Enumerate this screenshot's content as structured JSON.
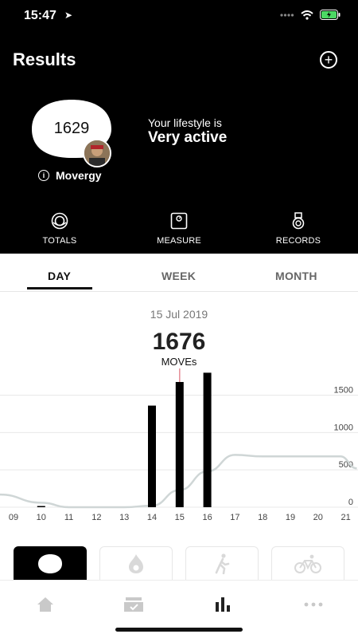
{
  "status_bar": {
    "time": "15:47"
  },
  "header": {
    "title": "Results"
  },
  "score": {
    "value": "1629",
    "name": "Movergy"
  },
  "lifestyle": {
    "label": "Your lifestyle is",
    "value": "Very active"
  },
  "top_nav": [
    {
      "label": "TOTALS",
      "icon": "totals-icon"
    },
    {
      "label": "MEASURE",
      "icon": "scale-icon"
    },
    {
      "label": "RECORDS",
      "icon": "medal-icon"
    }
  ],
  "tabs": [
    {
      "label": "DAY",
      "active": true
    },
    {
      "label": "WEEK",
      "active": false
    },
    {
      "label": "MONTH",
      "active": false
    }
  ],
  "summary": {
    "date": "15 Jul 2019",
    "value": "1676",
    "unit": "MOVEs"
  },
  "chart_data": {
    "type": "bar",
    "x": [
      "09",
      "10",
      "11",
      "12",
      "13",
      "14",
      "15",
      "16",
      "17",
      "18",
      "19",
      "20",
      "21"
    ],
    "bars": [
      {
        "x": 10,
        "y": 10
      },
      {
        "x": 14,
        "y": 1360
      },
      {
        "x": 15,
        "y": 1676
      },
      {
        "x": 16,
        "y": 1800
      }
    ],
    "line": [
      {
        "x": 8.5,
        "y": 170
      },
      {
        "x": 10,
        "y": 60
      },
      {
        "x": 11,
        "y": 0
      },
      {
        "x": 13,
        "y": 0
      },
      {
        "x": 14,
        "y": 20
      },
      {
        "x": 15,
        "y": 230
      },
      {
        "x": 16,
        "y": 480
      },
      {
        "x": 17,
        "y": 700
      },
      {
        "x": 18,
        "y": 680
      },
      {
        "x": 19,
        "y": 680
      },
      {
        "x": 20,
        "y": 680
      },
      {
        "x": 20.8,
        "y": 680
      },
      {
        "x": 21.4,
        "y": 520
      }
    ],
    "yticks": [
      "0",
      "500",
      "1000",
      "1500"
    ],
    "ylim": [
      0,
      1900
    ],
    "highlight_x": 15,
    "colors": {
      "bar": "#000000",
      "line": "#cfd6d6",
      "highlight": "#e58d96",
      "grid": "#e8e8e8"
    }
  },
  "activity_cards": [
    {
      "icon": "movergy-blob-icon",
      "active": true
    },
    {
      "icon": "flame-icon",
      "active": false
    },
    {
      "icon": "walking-icon",
      "active": false
    },
    {
      "icon": "bike-icon",
      "active": false
    }
  ],
  "tabbar": [
    {
      "icon": "home-icon"
    },
    {
      "icon": "inbox-icon"
    },
    {
      "icon": "bar-chart-icon",
      "active": true
    },
    {
      "icon": "more-icon"
    }
  ]
}
